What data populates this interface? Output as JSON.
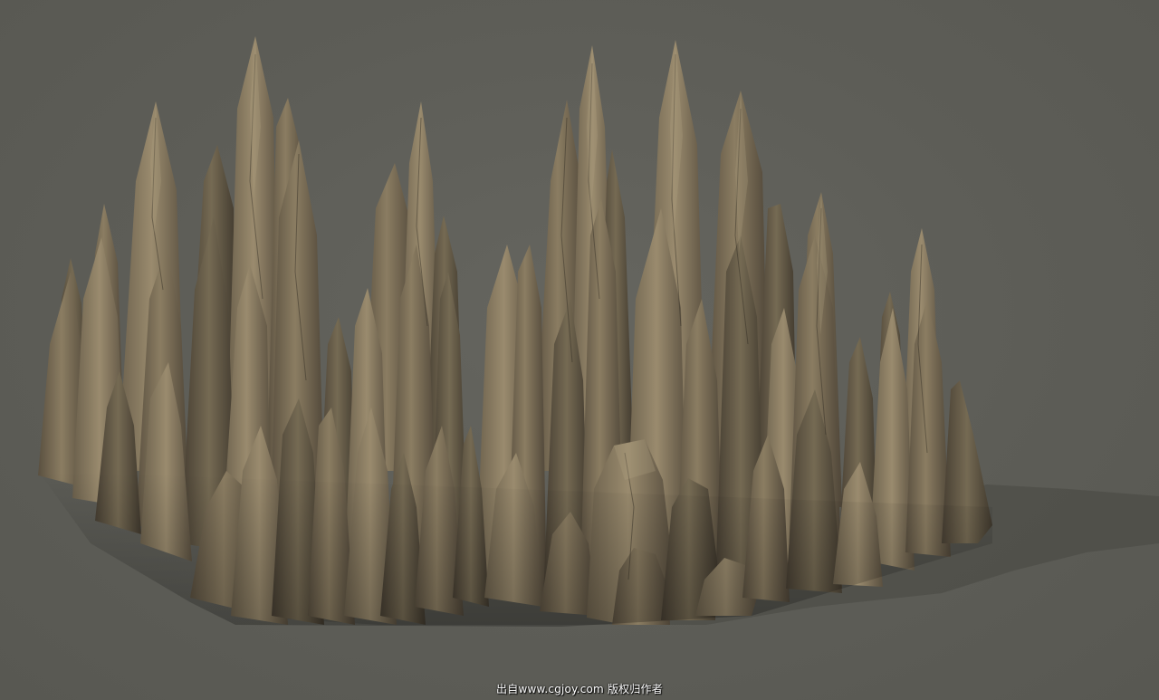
{
  "scene": {
    "subject": "rock-spire-cluster-model",
    "colors": {
      "background": "#5c5c56",
      "rock_light": "#8a7c62",
      "rock_mid": "#6e624c",
      "rock_dark": "#4a4235",
      "shadow": "#4e4e48"
    }
  },
  "watermark": {
    "text": "出自www.cgjoy.com 版权归作者"
  }
}
